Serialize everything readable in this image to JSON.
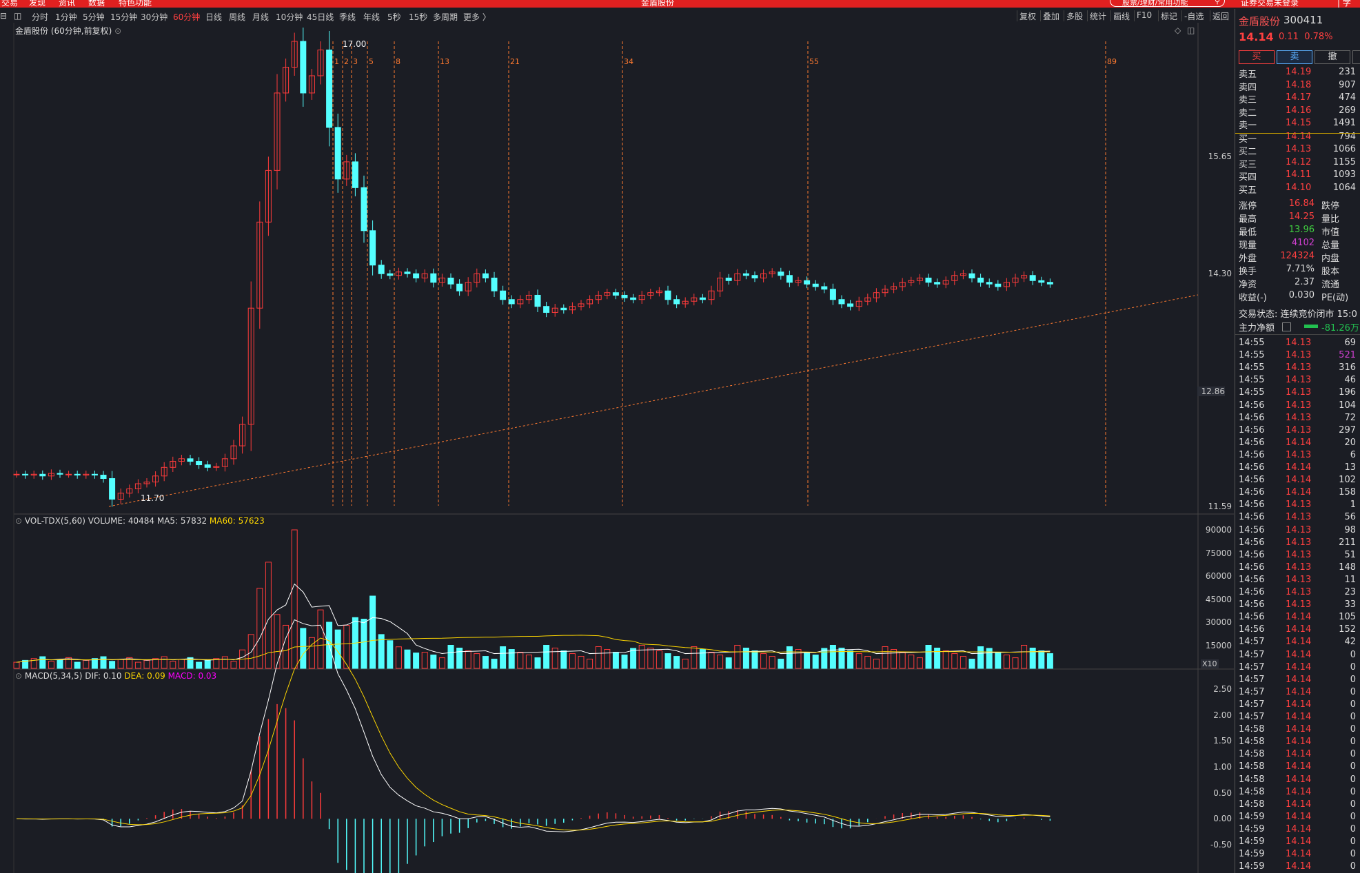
{
  "topbar": {
    "items": [
      "交易",
      "发现",
      "资讯",
      "数据",
      "特色功能"
    ],
    "center_title": "金盾股份",
    "search_placeholder": "股票/理财/常用功能",
    "right_text": "证券交易未登录",
    "far_right": "| 学"
  },
  "toolbar": {
    "periods": [
      "分时",
      "1分钟",
      "5分钟",
      "15分钟",
      "30分钟",
      "60分钟",
      "日线",
      "周线",
      "月线",
      "10分钟",
      "45日线",
      "季线",
      "年线",
      "5秒",
      "15秒",
      "多周期",
      "更多 〉"
    ],
    "active_period": "60分钟",
    "right_tools": [
      "复权",
      "叠加",
      "多股",
      "统计",
      "画线",
      "F10",
      "标记",
      "-自选",
      "返回"
    ]
  },
  "chart": {
    "title": "金盾股份 (60分钟,前复权)",
    "price_axis": [
      "15.65",
      "14.30",
      "12.86",
      "11.59"
    ],
    "high_label": "17.00",
    "low_label": "11.70",
    "fib_labels": [
      "1",
      "2",
      "3",
      "5",
      "8",
      "13",
      "21",
      "34",
      "55",
      "89"
    ],
    "vol_title": "VOL-TDX(5,60)",
    "vol_volume": "VOLUME: 40484",
    "vol_ma5": "MA5: 57832",
    "vol_ma60": "MA60: 57623",
    "vol_axis": [
      "90000",
      "75000",
      "60000",
      "45000",
      "30000",
      "15000"
    ],
    "vol_unit": "X10",
    "macd_title": "MACD(5,34,5)",
    "macd_dif": "DIF: 0.10",
    "macd_dea": "DEA: 0.09",
    "macd_val": "MACD: 0.03",
    "macd_axis": [
      "2.50",
      "2.00",
      "1.50",
      "1.00",
      "0.50",
      "0.00",
      "-0.50"
    ]
  },
  "colors": {
    "up": "#ff3b3b",
    "down": "#54ffff",
    "ma5": "#ffffff",
    "ma60": "#ffd700",
    "macd": "#ff00ff",
    "trend": "#ff7a30"
  },
  "quote": {
    "name": "金盾股份",
    "code": "300411",
    "price": "14.14",
    "change": "0.11",
    "change_pct": "0.78%",
    "buttons": [
      "买",
      "卖",
      "撤"
    ],
    "sells": [
      {
        "label": "卖五",
        "price": "14.19",
        "vol": "231"
      },
      {
        "label": "卖四",
        "price": "14.18",
        "vol": "907"
      },
      {
        "label": "卖三",
        "price": "14.17",
        "vol": "474"
      },
      {
        "label": "卖二",
        "price": "14.16",
        "vol": "269"
      },
      {
        "label": "卖一",
        "price": "14.15",
        "vol": "1491"
      }
    ],
    "buys": [
      {
        "label": "买一",
        "price": "14.14",
        "vol": "794"
      },
      {
        "label": "买二",
        "price": "14.13",
        "vol": "1066"
      },
      {
        "label": "买三",
        "price": "14.12",
        "vol": "1155"
      },
      {
        "label": "买四",
        "price": "14.11",
        "vol": "1093"
      },
      {
        "label": "买五",
        "price": "14.10",
        "vol": "1064"
      }
    ],
    "stats": [
      {
        "k": "涨停",
        "v": "16.84",
        "c": "#ff4040",
        "k2": "跌停"
      },
      {
        "k": "最高",
        "v": "14.25",
        "c": "#ff4040",
        "k2": "量比"
      },
      {
        "k": "最低",
        "v": "13.96",
        "c": "#40d040",
        "k2": "市值"
      },
      {
        "k": "现量",
        "v": "4102",
        "c": "#d040d0",
        "k2": "总量"
      },
      {
        "k": "外盘",
        "v": "124324",
        "c": "#ff4040",
        "k2": "内盘"
      },
      {
        "k": "换手",
        "v": "7.71%",
        "c": "#ddd",
        "k2": "股本"
      },
      {
        "k": "净资",
        "v": "2.37",
        "c": "#ddd",
        "k2": "流通"
      },
      {
        "k": "收益(-)",
        "v": "0.030",
        "c": "#ddd",
        "k2": "PE(动)"
      }
    ],
    "status_label": "交易状态: 连续竞价闭市 15:0",
    "main_flow_label": "主力净额",
    "main_flow_value": "-81.26万"
  },
  "ticks": [
    [
      "14:55",
      "14.13",
      "69"
    ],
    [
      "14:55",
      "14.13",
      "521"
    ],
    [
      "14:55",
      "14.13",
      "316"
    ],
    [
      "14:55",
      "14.13",
      "46"
    ],
    [
      "14:55",
      "14.13",
      "196"
    ],
    [
      "14:56",
      "14.13",
      "104"
    ],
    [
      "14:56",
      "14.13",
      "72"
    ],
    [
      "14:56",
      "14.13",
      "297"
    ],
    [
      "14:56",
      "14.14",
      "20"
    ],
    [
      "14:56",
      "14.13",
      "6"
    ],
    [
      "14:56",
      "14.14",
      "13"
    ],
    [
      "14:56",
      "14.14",
      "102"
    ],
    [
      "14:56",
      "14.14",
      "158"
    ],
    [
      "14:56",
      "14.13",
      "1"
    ],
    [
      "14:56",
      "14.13",
      "56"
    ],
    [
      "14:56",
      "14.13",
      "98"
    ],
    [
      "14:56",
      "14.13",
      "211"
    ],
    [
      "14:56",
      "14.13",
      "51"
    ],
    [
      "14:56",
      "14.13",
      "148"
    ],
    [
      "14:56",
      "14.13",
      "11"
    ],
    [
      "14:56",
      "14.13",
      "23"
    ],
    [
      "14:56",
      "14.13",
      "33"
    ],
    [
      "14:56",
      "14.14",
      "105"
    ],
    [
      "14:56",
      "14.14",
      "152"
    ],
    [
      "14:57",
      "14.14",
      "42"
    ],
    [
      "14:57",
      "14.14",
      "0"
    ],
    [
      "14:57",
      "14.14",
      "0"
    ],
    [
      "14:57",
      "14.14",
      "0"
    ],
    [
      "14:57",
      "14.14",
      "0"
    ],
    [
      "14:57",
      "14.14",
      "0"
    ],
    [
      "14:57",
      "14.14",
      "0"
    ],
    [
      "14:58",
      "14.14",
      "0"
    ],
    [
      "14:58",
      "14.14",
      "0"
    ],
    [
      "14:58",
      "14.14",
      "0"
    ],
    [
      "14:58",
      "14.14",
      "0"
    ],
    [
      "14:58",
      "14.14",
      "0"
    ],
    [
      "14:58",
      "14.14",
      "0"
    ],
    [
      "14:58",
      "14.14",
      "0"
    ],
    [
      "14:59",
      "14.14",
      "0"
    ],
    [
      "14:59",
      "14.14",
      "0"
    ],
    [
      "14:59",
      "14.14",
      "0"
    ],
    [
      "14:59",
      "14.14",
      "0"
    ],
    [
      "14:59",
      "14.14",
      "0"
    ]
  ]
}
